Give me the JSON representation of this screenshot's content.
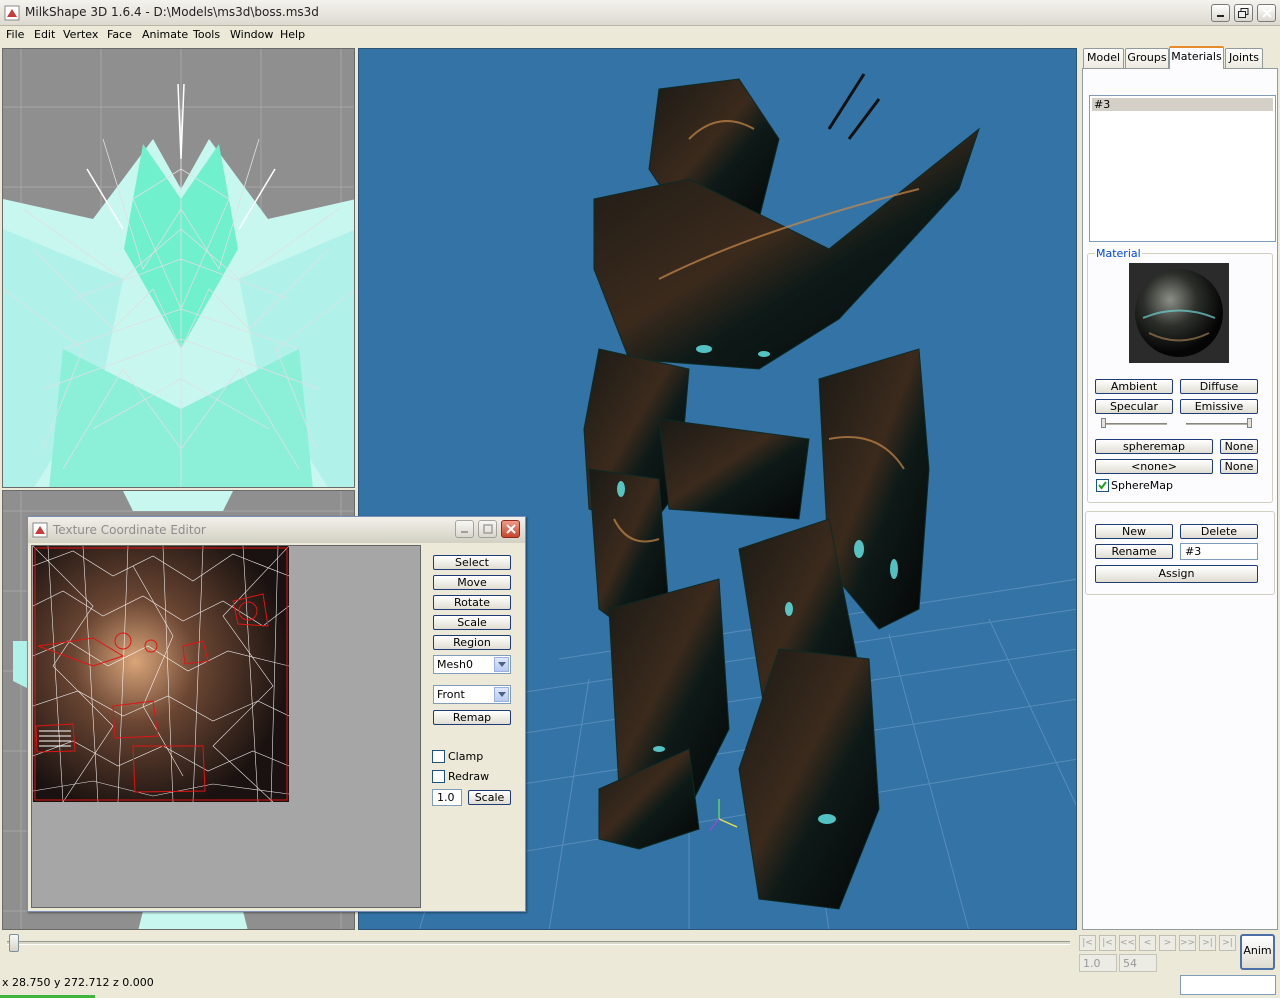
{
  "window": {
    "title": "MilkShape 3D 1.6.4 - D:\\Models\\ms3d\\boss.ms3d",
    "icons": {
      "app": "milkshape-app-icon",
      "minimize": "minimize-icon",
      "maximize": "restore-icon",
      "close": "close-icon"
    }
  },
  "menu": {
    "items": [
      "File",
      "Edit",
      "Vertex",
      "Face",
      "Animate",
      "Tools",
      "Window",
      "Help"
    ]
  },
  "texture_editor": {
    "title": "Texture Coordinate Editor",
    "buttons": {
      "select": "Select",
      "move": "Move",
      "rotate": "Rotate",
      "scale": "Scale",
      "region": "Region",
      "remap": "Remap",
      "scale_apply": "Scale"
    },
    "mesh_select": "Mesh0",
    "view_select": "Front",
    "clamp_label": "Clamp",
    "clamp_checked": false,
    "redraw_label": "Redraw",
    "redraw_checked": false,
    "scale_value": "1.0"
  },
  "right_panel": {
    "tabs": [
      "Model",
      "Groups",
      "Materials",
      "Joints"
    ],
    "active_tab": "Materials",
    "material_list": [
      "#3"
    ],
    "material_group_label": "Material",
    "buttons": {
      "ambient": "Ambient",
      "diffuse": "Diffuse",
      "specular": "Specular",
      "emissive": "Emissive",
      "texture1": "spheremap",
      "texture1_none": "None",
      "texture2": "<none>",
      "texture2_none": "None",
      "new": "New",
      "delete": "Delete",
      "rename": "Rename",
      "assign": "Assign"
    },
    "spheremap_label": "SphereMap",
    "spheremap_checked": true,
    "rename_value": "#3",
    "shininess_level": 0.0,
    "transparency_level": 1.0
  },
  "timeline": {
    "position": 0.0,
    "nav_icons": [
      "first-frame-icon",
      "prev-key-icon",
      "rewind-icon",
      "prev-frame-icon",
      "next-frame-icon",
      "fast-forward-icon",
      "next-key-icon",
      "last-frame-icon"
    ],
    "nav_glyphs": [
      "|<",
      "|<",
      "<<",
      "<",
      ">",
      ">>",
      ">|",
      ">|"
    ],
    "frame_value": "1.0",
    "total_frames": "54",
    "anim_button": "Anim"
  },
  "status": {
    "coordinates": "x 28.750 y 272.712 z 0.000"
  },
  "colors": {
    "viewport_3d_bg": "#3373a6",
    "viewport_2d_bg": "#8f8f8f",
    "wire_cyan": "#9ff5e6",
    "uv_red": "#d31a1a",
    "active_tab_accent": "#e68b2c"
  }
}
